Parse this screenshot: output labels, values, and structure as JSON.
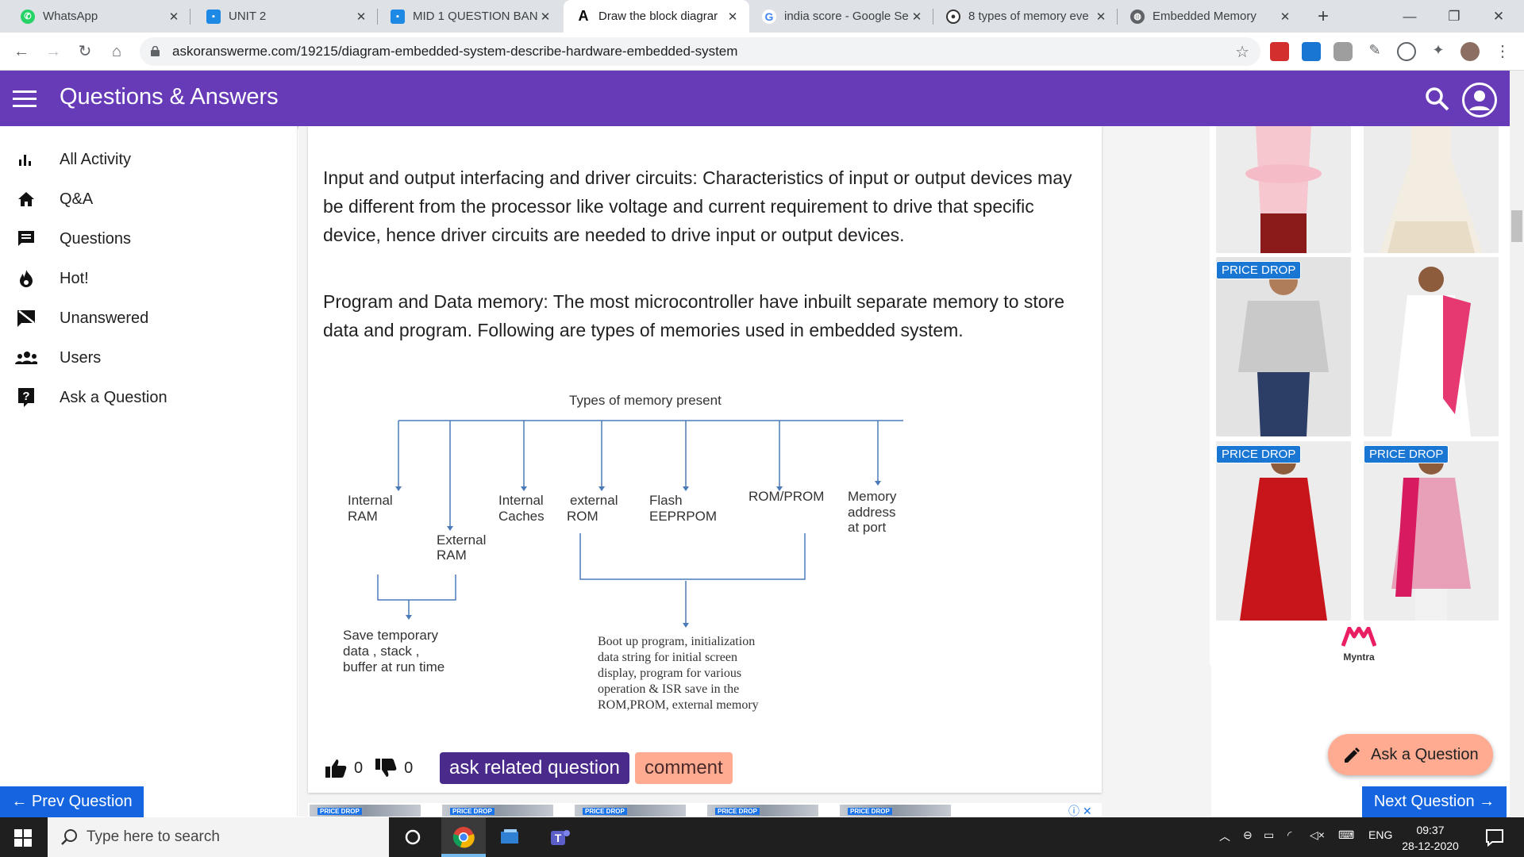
{
  "browser": {
    "tabs": [
      {
        "title": "WhatsApp",
        "icon": "whatsapp-icon",
        "color": "#25d366"
      },
      {
        "title": "UNIT 2",
        "icon": "classroom-icon",
        "color": "#1e88e5"
      },
      {
        "title": "MID 1 QUESTION BAN",
        "icon": "classroom-icon",
        "color": "#1e88e5"
      },
      {
        "title": "Draw the block diagrar",
        "icon": "site-icon",
        "color": "#000000"
      },
      {
        "title": "india score - Google Se",
        "icon": "google-icon",
        "color": "#4285f4"
      },
      {
        "title": "8 types of memory eve",
        "icon": "site-icon",
        "color": "#333333"
      },
      {
        "title": "Embedded Memory",
        "icon": "globe-icon",
        "color": "#5f6368"
      }
    ],
    "new_tab_label": "+",
    "url": "askoranswerme.com/19215/diagram-embedded-system-describe-hardware-embedded-system"
  },
  "site": {
    "title": "Questions & Answers",
    "accent": "#673ab7"
  },
  "sidebar": {
    "items": [
      {
        "label": "All Activity",
        "icon": "bar-chart-icon"
      },
      {
        "label": "Q&A",
        "icon": "home-icon"
      },
      {
        "label": "Questions",
        "icon": "chat-icon"
      },
      {
        "label": "Hot!",
        "icon": "flame-icon"
      },
      {
        "label": "Unanswered",
        "icon": "unanswered-icon"
      },
      {
        "label": "Users",
        "icon": "users-icon"
      },
      {
        "label": "Ask a Question",
        "icon": "question-icon"
      }
    ]
  },
  "content": {
    "para1": "Input and output interfacing and driver circuits: Characteristics of input or output devices may be different from the processor like voltage and current requirement to drive that specific device, hence driver circuits are needed to drive input or output devices.",
    "para2": "Program and Data memory: The most microcontroller have inbuilt separate memory to store data and program. Following are types of memories used in embedded system.",
    "diagram": {
      "title": "Types of memory present",
      "internal_ram": [
        "Internal",
        "RAM"
      ],
      "external_ram": [
        "External",
        "RAM"
      ],
      "internal_caches": [
        "Internal",
        "Caches"
      ],
      "external_rom": [
        "external",
        "ROM"
      ],
      "flash": [
        "Flash",
        "EEPRPOM"
      ],
      "rom_prom": "ROM/PROM",
      "memory_port": [
        "Memory",
        "address",
        "at port"
      ],
      "save_note": [
        "Save temporary",
        "data , stack ,",
        "buffer at run time"
      ],
      "boot_note": [
        "Boot up program, initialization",
        "data string for initial screen",
        "display, program for various",
        "operation & ISR save in the",
        "ROM,PROM, external memory"
      ]
    },
    "upvotes": "0",
    "downvotes": "0",
    "related_label": "ask related question",
    "comment_label": "comment"
  },
  "nav": {
    "prev": "← Prev Question",
    "next": "Next Question →",
    "ask_fab": "Ask a Question"
  },
  "ads": {
    "badge": "PRICE DROP",
    "brand": "Myntra"
  },
  "taskbar": {
    "search_placeholder": "Type here to search",
    "lang": "ENG",
    "time": "09:37",
    "date": "28-12-2020"
  }
}
